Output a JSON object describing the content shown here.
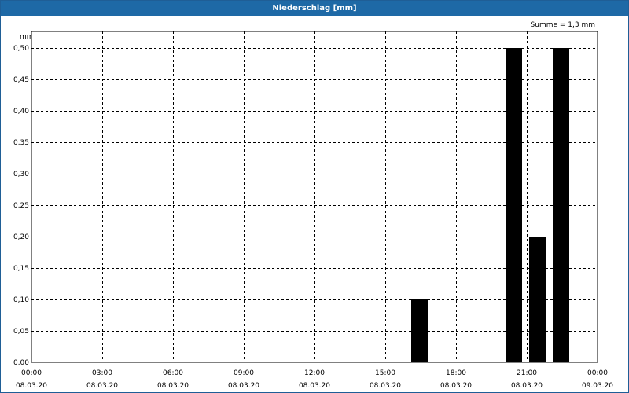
{
  "window": {
    "title": "Niederschlag [mm]"
  },
  "chart_data": {
    "type": "bar",
    "title": "Niederschlag [mm]",
    "unit_label": "mm",
    "summary": "Summe = 1,3 mm",
    "xlabel": "",
    "ylabel": "mm",
    "x_unit": "hours since 00:00 08.03.20",
    "xlim": [
      0,
      24
    ],
    "ylim": [
      0,
      0.5
    ],
    "y_ticks": [
      0,
      0.05,
      0.1,
      0.15,
      0.2,
      0.25,
      0.3,
      0.35,
      0.4,
      0.45,
      0.5
    ],
    "y_tick_labels": [
      "0,00",
      "0,05",
      "0,10",
      "0,15",
      "0,20",
      "0,25",
      "0,30",
      "0,35",
      "0,40",
      "0,45",
      "0,50"
    ],
    "x_ticks": [
      0,
      3,
      6,
      9,
      12,
      15,
      18,
      21,
      24
    ],
    "x_tick_times": [
      "00:00",
      "03:00",
      "06:00",
      "09:00",
      "12:00",
      "15:00",
      "18:00",
      "21:00",
      "00:00"
    ],
    "x_tick_dates": [
      "08.03.20",
      "08.03.20",
      "08.03.20",
      "08.03.20",
      "08.03.20",
      "08.03.20",
      "08.03.20",
      "08.03.20",
      "09.03.20"
    ],
    "bars": [
      {
        "start": 16.1,
        "end": 16.8,
        "value": 0.1
      },
      {
        "start": 20.1,
        "end": 20.8,
        "value": 0.5
      },
      {
        "start": 21.1,
        "end": 21.8,
        "value": 0.2
      },
      {
        "start": 22.1,
        "end": 22.8,
        "value": 0.5
      }
    ],
    "grid": true,
    "grid_style": "dashed",
    "bar_color": "#000000",
    "title_bar_color": "#1e69a6"
  }
}
